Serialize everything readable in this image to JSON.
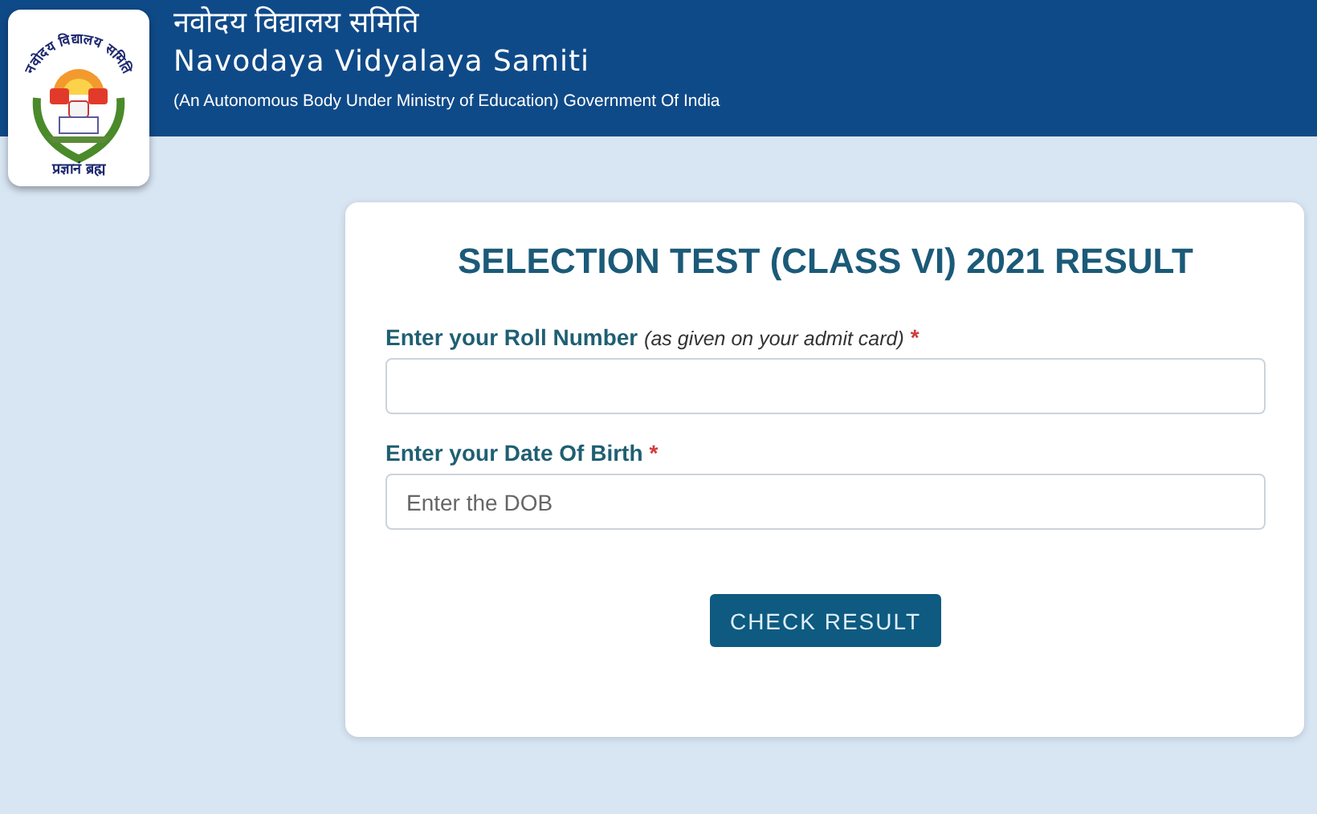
{
  "header": {
    "logo": {
      "arc_text": "नवोदय विद्यालय समिति",
      "motto": "प्रज्ञानं ब्रह्म"
    },
    "title_hindi": "नवोदय विद्यालय समिति",
    "title": "Navodaya Vidyalaya Samiti",
    "subtitle": "(An Autonomous Body Under Ministry of Education) Government Of India"
  },
  "form": {
    "title": "SELECTION TEST (CLASS VI) 2021 RESULT",
    "fields": [
      {
        "label": "Enter your Roll Number *(as given on your admit card)*",
        "required_mark": "*"
      },
      {
        "label": "Enter your Date Of Birth",
        "required_mark": "*",
        "placeholder": "Enter the DOB"
      }
    ],
    "button": "CHECK RESULT"
  }
}
